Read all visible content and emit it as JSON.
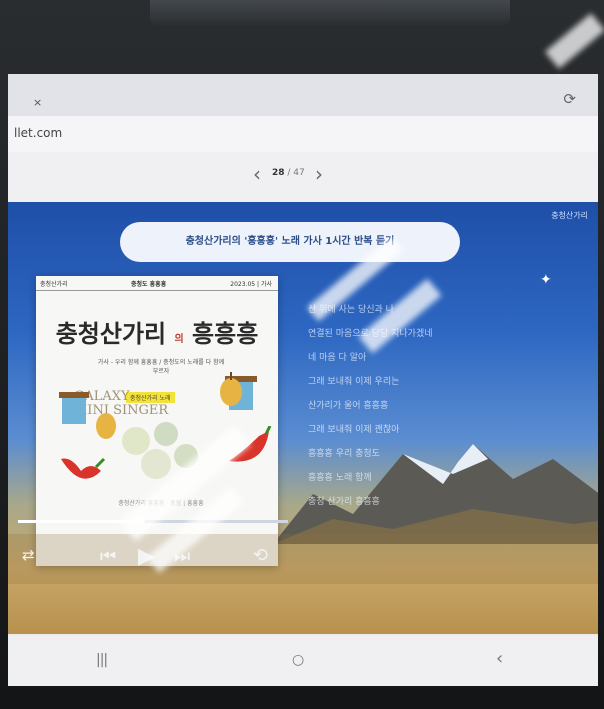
{
  "browser": {
    "url": "llet.com",
    "tab_close": "×",
    "reload_icon": "⟳"
  },
  "pager": {
    "prev": "‹",
    "current": "28",
    "total": "/ 47",
    "next": "›"
  },
  "slide": {
    "title": "충청산가리의 '흥흥흥' 노래 가사 1시간 반복 듣기",
    "corner_label": "충청산가리",
    "lyrics": [
      "산 위에 사는 당신과 나",
      "연결된 마음으로 당당 지나가겠네",
      "네 마음 다 알아",
      "그래 보내줘 이제 우리는",
      "산가리가 울어 흥흥흥",
      "그래 보내줘 이제 괜찮아",
      "흥흥흥 우리 충청도",
      "흥흥흥 노래 함께",
      "충청 산가리 흥흥흥"
    ]
  },
  "album": {
    "header_left": "충청산가리",
    "header_center": "충청도 흥흥흥",
    "header_right": "2023.05 | 가사",
    "title_main": "충청산가리",
    "title_of": "의",
    "title_end": "흥흥흥",
    "subtitle": "가사 - 우리 함께 흥흥흥 / 충청도의 노래를 다 함께 부르자",
    "chip": "충청산가리 노래",
    "galaxy_line1": "GALAXY",
    "galaxy_line2": "MINI SINGER",
    "footer": "충청산가리 흥흥흥 · 충청 | 흥흥흥"
  },
  "player": {
    "progress": 0.45,
    "shuffle_icon": "⇄",
    "prev_icon": "⏮",
    "play_icon": "▶",
    "next_icon": "⏭",
    "repeat_icon": "⟲"
  },
  "system_nav": {
    "recents": "|||",
    "home": "○",
    "back": "‹"
  }
}
